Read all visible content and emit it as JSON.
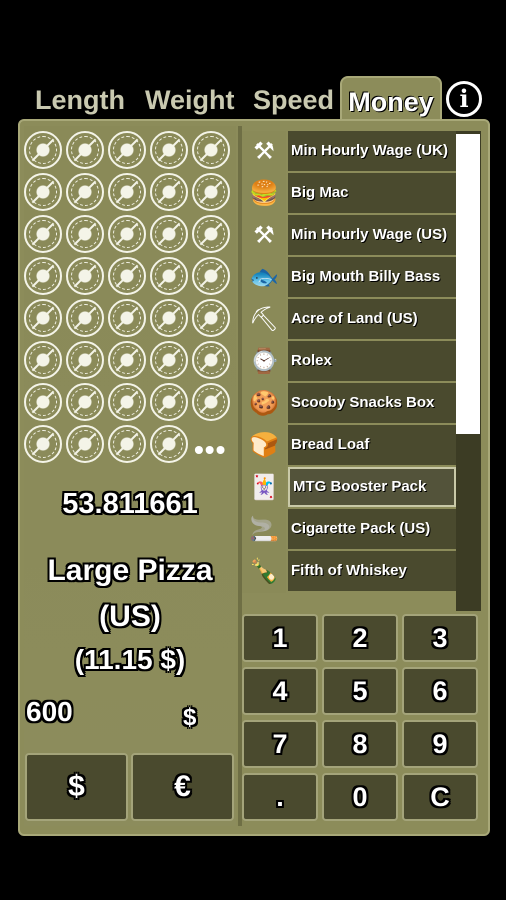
{
  "tabs": {
    "length": "Length",
    "weight": "Weight",
    "speed": "Speed",
    "money": "Money",
    "active": "Money"
  },
  "info_icon": "i",
  "result": {
    "value": "53.811661",
    "unit_name_line1": "Large Pizza",
    "unit_name_line2": "(US)",
    "unit_price": "(11.15 $)",
    "pizza_icons_shown": 39,
    "more_indicator": "•••"
  },
  "input": {
    "amount": "600",
    "currency_symbol": "$"
  },
  "currency_buttons": [
    "$",
    "€"
  ],
  "units": [
    {
      "label": "Min Hourly Wage (UK)",
      "icon": "wage-icon",
      "glyph": "⚒"
    },
    {
      "label": "Big Mac",
      "icon": "burger-icon",
      "glyph": "🍔"
    },
    {
      "label": "Min Hourly Wage (US)",
      "icon": "wage-icon",
      "glyph": "⚒"
    },
    {
      "label": "Big Mouth Billy Bass",
      "icon": "fish-icon",
      "glyph": "🐟"
    },
    {
      "label": "Acre of Land (US)",
      "icon": "farmer-icon",
      "glyph": "⛏"
    },
    {
      "label": "Rolex",
      "icon": "watch-icon",
      "glyph": "⌚"
    },
    {
      "label": "Scooby Snacks Box",
      "icon": "snacks-icon",
      "glyph": "🍪"
    },
    {
      "label": "Bread Loaf",
      "icon": "bread-icon",
      "glyph": "🍞"
    },
    {
      "label": "MTG Booster Pack",
      "icon": "cards-icon",
      "glyph": "🃏"
    },
    {
      "label": "Cigarette Pack (US)",
      "icon": "cigarette-icon",
      "glyph": "🚬"
    },
    {
      "label": "Fifth of Whiskey",
      "icon": "bottle-icon",
      "glyph": "🍾"
    }
  ],
  "selected_unit": "MTG Booster Pack",
  "keypad": [
    "1",
    "2",
    "3",
    "4",
    "5",
    "6",
    "7",
    "8",
    "9",
    ".",
    "0",
    "C"
  ],
  "colors": {
    "panel": "#8c8c5a",
    "button": "#4a4a2e",
    "accent": "#ffffff"
  }
}
